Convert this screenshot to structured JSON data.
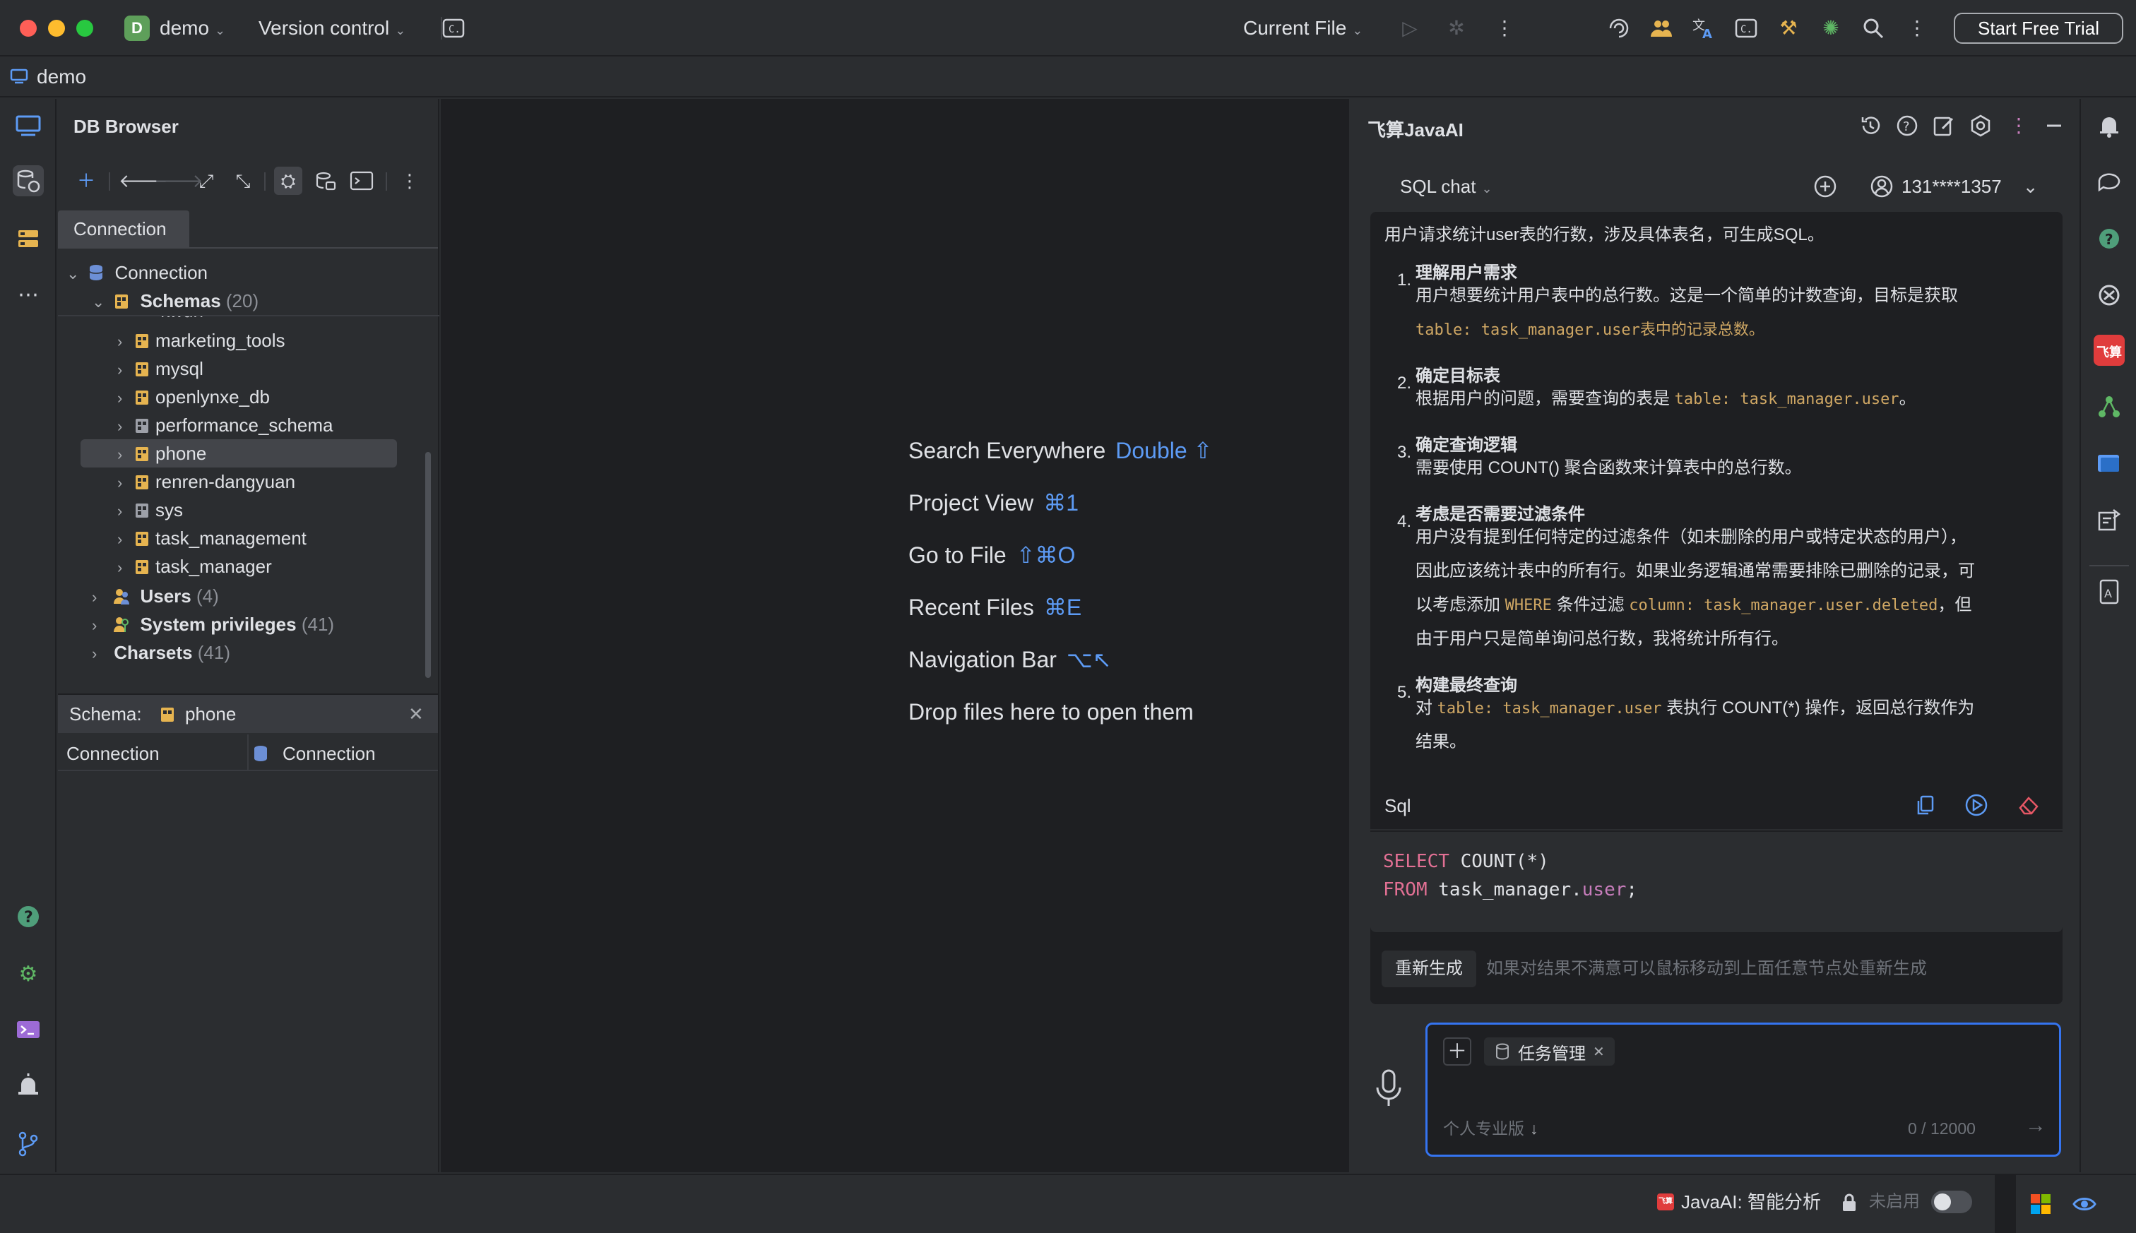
{
  "titlebar": {
    "project_initial": "D",
    "project_name": "demo",
    "version_control": "Version control",
    "run_config": "Current File",
    "trial_button": "Start Free Trial"
  },
  "breadcrumb": {
    "project": "demo"
  },
  "db_browser": {
    "title": "DB Browser",
    "tab": "Connection",
    "tree": {
      "root": "Connection",
      "schemas_label": "Schemas",
      "schemas_count": "(20)",
      "partial_item": "kwun",
      "schemas": [
        "marketing_tools",
        "mysql",
        "openlynxe_db",
        "performance_schema",
        "phone",
        "renren-dangyuan",
        "sys",
        "task_management",
        "task_manager"
      ],
      "selected_schema": "phone",
      "users_label": "Users",
      "users_count": "(4)",
      "privileges_label": "System privileges",
      "privileges_count": "(41)",
      "charsets_label": "Charsets",
      "charsets_count": "(41)"
    },
    "schema_bar": {
      "label": "Schema:",
      "value": "phone"
    },
    "props": {
      "key": "Connection",
      "value": "Connection"
    }
  },
  "center_hints": [
    {
      "label": "Search Everywhere",
      "key": "Double ⇧"
    },
    {
      "label": "Project View",
      "key": "⌘1"
    },
    {
      "label": "Go to File",
      "key": "⇧⌘O"
    },
    {
      "label": "Recent Files",
      "key": "⌘E"
    },
    {
      "label": "Navigation Bar",
      "key": "⌥↖"
    },
    {
      "label": "Drop files here to open them",
      "key": ""
    }
  ],
  "ai_panel": {
    "title": "飞算JavaAI",
    "mode": "SQL chat",
    "account": "131****1357",
    "intro": "用户请求统计user表的行数，涉及具体表名，可生成SQL。",
    "steps": [
      {
        "num": "1.",
        "title": "理解用户需求",
        "lines": [
          "用户想要统计用户表中的总行数。这是一个简单的计数查询，目标是获取",
          "table: task_manager.user|表中的记录总数。"
        ]
      },
      {
        "num": "2.",
        "title": "确定目标表",
        "lines": [
          "根据用户的问题，需要查询的表是 |table: task_manager.user|。"
        ]
      },
      {
        "num": "3.",
        "title": "确定查询逻辑",
        "lines": [
          "需要使用 COUNT() 聚合函数来计算表中的总行数。"
        ]
      },
      {
        "num": "4.",
        "title": "考虑是否需要过滤条件",
        "lines": [
          "用户没有提到任何特定的过滤条件（如未删除的用户或特定状态的用户），",
          "因此应该统计表中的所有行。如果业务逻辑通常需要排除已删除的记录，可",
          "以考虑添加 |WHERE| 条件过滤 |column: task_manager.user.deleted|，但",
          "由于用户只是简单询问总行数，我将统计所有行。"
        ]
      },
      {
        "num": "5.",
        "title": "构建最终查询",
        "lines": [
          "对 |table: task_manager.user| 表执行 COUNT(*) 操作，返回总行数作为",
          "结果。"
        ]
      }
    ],
    "sql_label": "Sql",
    "sql": {
      "line1_kw": "SELECT",
      "line1_rest": " COUNT(*)",
      "line2_kw": "FROM",
      "line2_table": " task_manager.",
      "line2_field": "user",
      "line2_end": ";"
    },
    "regenerate_button": "重新生成",
    "regenerate_hint": "如果对结果不满意可以鼠标移动到上面任意节点处重新生成",
    "input": {
      "chip": "任务管理",
      "edition": "个人专业版",
      "counter": "0 / 12000"
    }
  },
  "statusbar": {
    "plugin": "JavaAI:",
    "analysis": "智能分析",
    "state": "未启用"
  }
}
